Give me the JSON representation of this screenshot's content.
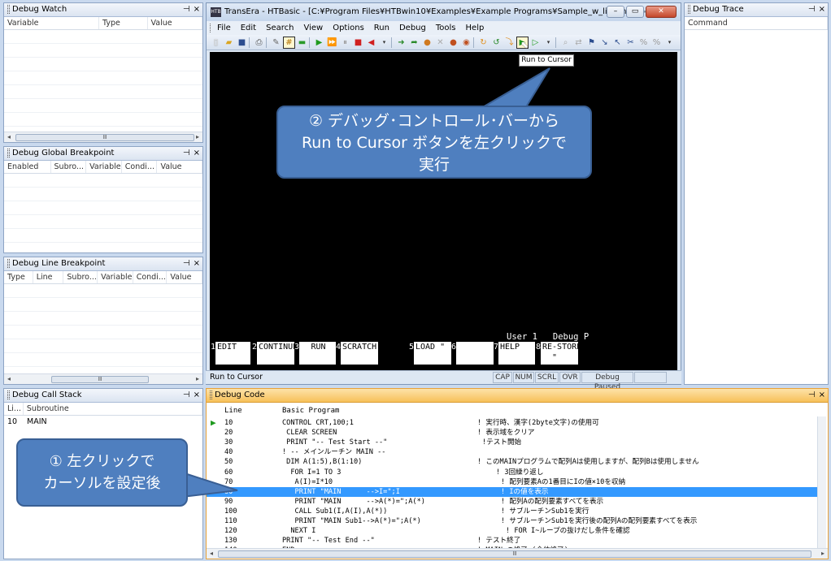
{
  "watch": {
    "title": "Debug Watch",
    "cols": [
      "Variable",
      "Type",
      "Value"
    ]
  },
  "global_bp": {
    "title": "Debug Global Breakpoint",
    "cols": [
      "Enabled",
      "Subro...",
      "Variable",
      "Condi...",
      "Value"
    ]
  },
  "line_bp": {
    "title": "Debug Line Breakpoint",
    "cols": [
      "Type",
      "Line",
      "Subro...",
      "Variable",
      "Condi...",
      "Value"
    ]
  },
  "callstack": {
    "title": "Debug Call Stack",
    "cols": [
      "Li...",
      "Subroutine"
    ],
    "rows": [
      {
        "line": "10",
        "sub": "MAIN"
      }
    ]
  },
  "trace": {
    "title": "Debug Trace",
    "cols": [
      "Command"
    ]
  },
  "panel_ctl": {
    "pin": "⊣",
    "close": "×"
  },
  "scroll_mark": "Ⅲ",
  "mainwin": {
    "title": "TransEra - HTBasic - [C:¥Program Files¥HTBwin10¥Examples¥Example Programs¥Sample_w_line_number.txt]",
    "menus": [
      "File",
      "Edit",
      "Search",
      "View",
      "Options",
      "Run",
      "Debug",
      "Tools",
      "Help"
    ],
    "tooltip": "Run to Cursor",
    "screen_status": "User 1   Debug P",
    "softkeys": [
      {
        "n": "1",
        "label": "EDIT"
      },
      {
        "n": "2",
        "label": "CONTINUE"
      },
      {
        "n": "3",
        "label": "RUN"
      },
      {
        "n": "4",
        "label": "SCRATCH"
      },
      {
        "n": "5",
        "label": "LOAD \""
      },
      {
        "n": "6",
        "label": ""
      },
      {
        "n": "7",
        "label": "HELP"
      },
      {
        "n": "8",
        "label": "RE-STORE\n  \""
      }
    ],
    "status_left": "Run to Cursor",
    "status_cells": [
      "CAP",
      "NUM",
      "SCRL",
      "OVR",
      "Debug Paused"
    ]
  },
  "callout2": {
    "lines": [
      "② デバッグ･コントロール･バーから",
      "Run to Cursor ボタンを左クリックで",
      "実行"
    ]
  },
  "callout1": {
    "lines": [
      "① 左クリックで",
      "カーソルを設定後"
    ]
  },
  "code": {
    "title": "Debug Code",
    "head_line": "Line",
    "head_prog": "Basic Program",
    "rows": [
      {
        "ln": "10",
        "src": "CONTROL CRT,100;1",
        "cm": "! 実行時、漢字(2byte文字)の使用可",
        "cmx": 140
      },
      {
        "ln": "20",
        "src": " CLEAR SCREEN",
        "cm": "! 表示域をクリア",
        "cmx": 140
      },
      {
        "ln": "30",
        "src": " PRINT \"-- Test Start --\"",
        "cm": "!テスト開始",
        "cmx": 146
      },
      {
        "ln": "40",
        "src": "! -- メインルーチン MAIN --",
        "cm": "",
        "cmx": 140
      },
      {
        "ln": "50",
        "src": " DIM A(1:5),B(1:10)",
        "cm": "! このMAINプログラムで配列Aは使用しますが、配列Bは使用しません",
        "cmx": 140
      },
      {
        "ln": "60",
        "src": "  FOR I=1 TO 3",
        "cm": "! 3回繰り返し",
        "cmx": 163
      },
      {
        "ln": "70",
        "src": "   A(I)=I*10",
        "cm": "! 配列要素Aの1番目にIの値×10を収納",
        "cmx": 169
      },
      {
        "ln": "80",
        "src": "   PRINT \"MAIN      -->I=\";I",
        "cm": "! Iの値を表示",
        "cmx": 169
      },
      {
        "ln": "90",
        "src": "   PRINT \"MAIN      -->A(*)=\";A(*)",
        "cm": "! 配列Aの配列要素すべてを表示",
        "cmx": 169
      },
      {
        "ln": "100",
        "src": "   CALL Sub1(I,A(I),A(*))",
        "cm": "! サブルーチンSub1を実行",
        "cmx": 169
      },
      {
        "ln": "110",
        "src": "   PRINT \"MAIN Sub1-->A(*)=\";A(*)",
        "cm": "! サブルーチンSub1を実行後の配列Aの配列要素すべてを表示",
        "cmx": 169
      },
      {
        "ln": "120",
        "src": "  NEXT I",
        "cm": "! FOR I~ループの抜けだし条件を確認",
        "cmx": 175
      },
      {
        "ln": "130",
        "src": "PRINT \"-- Test End --\"",
        "cm": "! テスト終了",
        "cmx": 140
      },
      {
        "ln": "140",
        "src": "END",
        "cm": "! MAIN の終了 (全体終了)",
        "cmx": 140
      }
    ],
    "current_line": "10",
    "selected_line": "80"
  },
  "colors": {
    "accent": "#3399ff",
    "callout": "#4f7fbf",
    "code_title": "#f7c15a"
  }
}
